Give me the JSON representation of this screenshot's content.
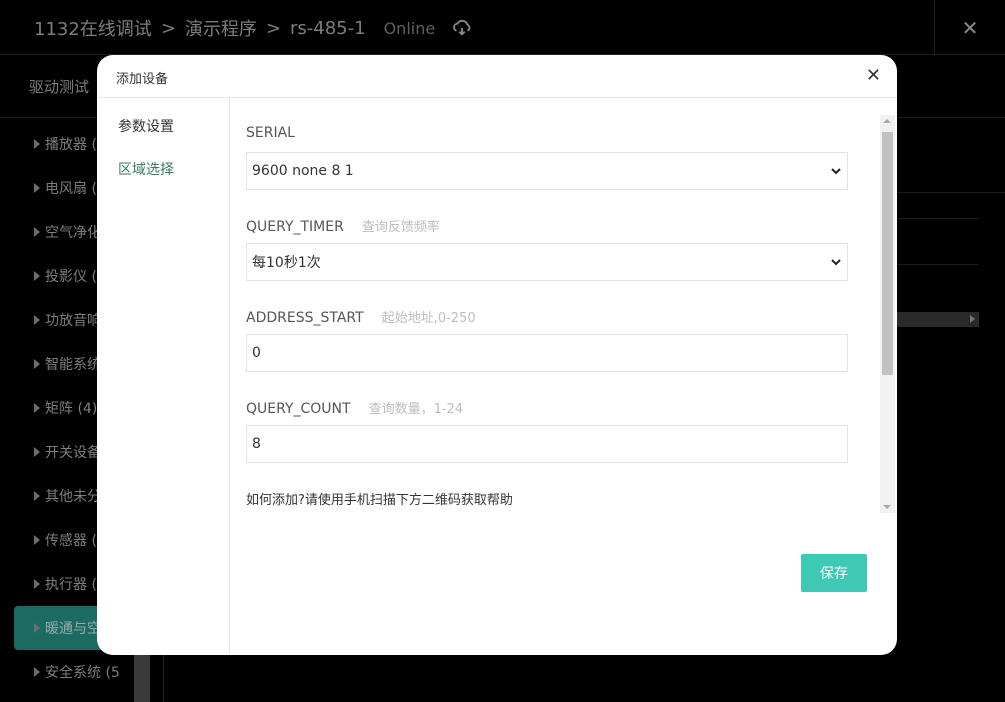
{
  "header": {
    "breadcrumb": [
      "1132在线调试",
      "演示程序",
      "rs-485-1"
    ],
    "separator": ">",
    "status": "Online",
    "cloud_icon": "cloud-sync-icon",
    "close_label": "✕"
  },
  "subheader": {
    "title": "驱动测试"
  },
  "sidebar": {
    "items": [
      {
        "label": "播放器 ("
      },
      {
        "label": "电风扇 ("
      },
      {
        "label": "空气净化"
      },
      {
        "label": "投影仪 ("
      },
      {
        "label": "功放音响"
      },
      {
        "label": "智能系统"
      },
      {
        "label": "矩阵 (4)"
      },
      {
        "label": "开关设备"
      },
      {
        "label": "其他未分"
      },
      {
        "label": "传感器 ("
      },
      {
        "label": "执行器 ("
      },
      {
        "label": "暖通与空"
      },
      {
        "label": "安全系统 (5"
      }
    ],
    "active_index": 11,
    "active_color": "#1c6b63"
  },
  "modal": {
    "title": "添加设备",
    "close_label": "✕",
    "nav": {
      "params": "参数设置",
      "area": "区域选择"
    },
    "fields": {
      "serial": {
        "label": "SERIAL",
        "hint": "",
        "value": "9600 none 8 1"
      },
      "query_timer": {
        "label": "QUERY_TIMER",
        "hint": "查询反馈频率",
        "value": "每10秒1次"
      },
      "address_start": {
        "label": "ADDRESS_START",
        "hint": "起始地址,0-250",
        "value": "0"
      },
      "query_count": {
        "label": "QUERY_COUNT",
        "hint": "查询数量，1-24",
        "value": "8"
      }
    },
    "help": "如何添加?请使用手机扫描下方二维码获取帮助",
    "save_label": "保存",
    "save_color": "#3ec9b4"
  }
}
